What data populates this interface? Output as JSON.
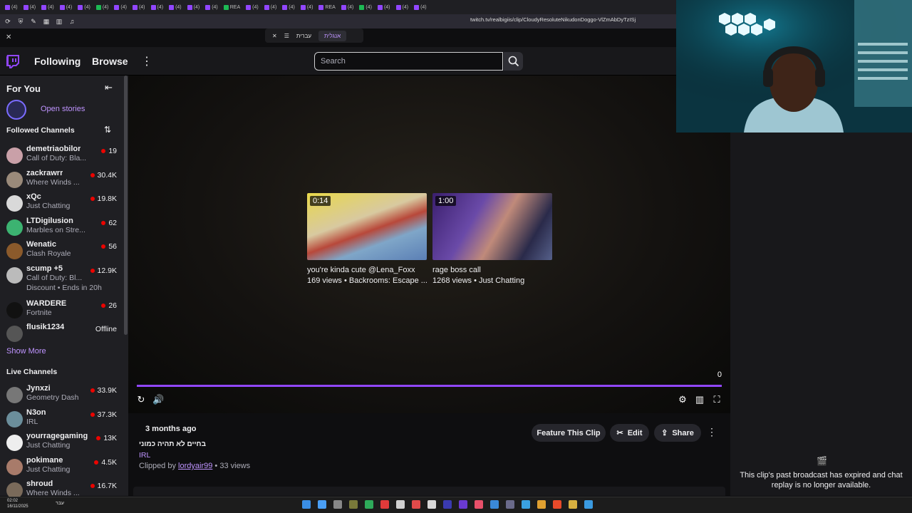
{
  "browser": {
    "url": "twitch.tv/realbigiis/clip/CloudyResoluteNikudonDoggo-VlZmAbDyTzISj-GF",
    "tabs": [
      "(4)",
      "(4)",
      "(4)",
      "(4)",
      "(4)",
      "(4)",
      "(4)",
      "(4)",
      "(4)",
      "(4)",
      "(4)",
      "(4)",
      "REA",
      "(4)",
      "(4)",
      "(4)",
      "(4)",
      "REA",
      "(4)",
      "(4)",
      "(4)",
      "(4)",
      "(4)"
    ],
    "translate_left": "עברית",
    "translate_right": "אנגלית"
  },
  "nav": {
    "following": "Following",
    "browse": "Browse",
    "more": "⋮",
    "search_placeholder": "Search"
  },
  "sidebar": {
    "for_you": "For You",
    "open_stories": "Open stories",
    "followed_header": "Followed Channels",
    "followed": [
      {
        "name": "demetriaobilor",
        "game": "Call of Duty: Bla...",
        "viewers": "19",
        "color": "#c9a0a8"
      },
      {
        "name": "zackrawrr",
        "game": "Where Winds ...",
        "viewers": "30.4K",
        "color": "#9a8a7a"
      },
      {
        "name": "xQc",
        "game": "Just Chatting",
        "viewers": "19.8K",
        "color": "#d9d9d9"
      },
      {
        "name": "LTDigilusion",
        "game": "Marbles on Stre...",
        "viewers": "62",
        "color": "#3cb371"
      },
      {
        "name": "Wenatic",
        "game": "Clash Royale",
        "viewers": "56",
        "color": "#8b5a2b"
      },
      {
        "name": "scump +5",
        "game": "Call of Duty: Bl...",
        "viewers": "12.9K",
        "color": "#bbbbbb",
        "extra": "Discount • Ends in 20h"
      },
      {
        "name": "WARDERE",
        "game": "Fortnite",
        "viewers": "26",
        "color": "#111111"
      },
      {
        "name": "flusik1234",
        "game": "",
        "viewers": "Offline",
        "color": "#555555"
      }
    ],
    "show_more": "Show More",
    "live_header": "Live Channels",
    "live": [
      {
        "name": "Jynxzi",
        "game": "Geometry Dash",
        "viewers": "33.9K",
        "color": "#777"
      },
      {
        "name": "N3on",
        "game": "IRL",
        "viewers": "37.3K",
        "color": "#6b8e9b"
      },
      {
        "name": "yourragegaming",
        "game": "Just Chatting",
        "viewers": "13K",
        "color": "#eeeeee"
      },
      {
        "name": "pokimane",
        "game": "Just Chatting",
        "viewers": "4.5K",
        "color": "#a87b6a"
      },
      {
        "name": "shroud",
        "game": "Where Winds ...",
        "viewers": "16.7K",
        "color": "#7a6a5a"
      }
    ]
  },
  "player": {
    "time_counter": "0",
    "progress": 1.0,
    "clips": [
      {
        "duration": "0:14",
        "title": "you're kinda cute @Lena_Foxx",
        "meta": "169 views • Backrooms: Escape ..."
      },
      {
        "duration": "1:00",
        "title": "rage boss call",
        "meta": "1268 views • Just Chatting"
      }
    ]
  },
  "clip_info": {
    "ago": "3 months ago",
    "title": "בחיים לא תהיה כמוני",
    "category": "IRL",
    "clipped_by_prefix": "Clipped by",
    "clipped_by_user": "lordyair99",
    "views": "• 33 views",
    "feature_label": "Feature This Clip",
    "edit_label": "Edit",
    "share_label": "Share"
  },
  "chat": {
    "message": "This clip's past broadcast has expired and chat replay is no longer available."
  },
  "taskbar": {
    "time": "02:02",
    "date": "16/11/2025",
    "lang": "עבר"
  },
  "colors": {
    "accent": "#9147ff",
    "live": "#eb0400",
    "link": "#bf94ff"
  }
}
